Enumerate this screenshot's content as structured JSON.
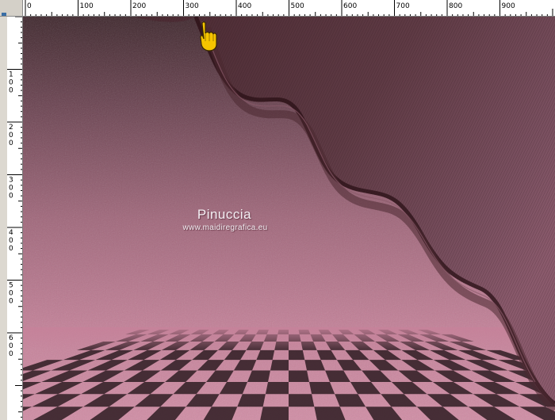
{
  "rulers": {
    "horizontal_labels": [
      "0",
      "100",
      "200",
      "300",
      "400",
      "500",
      "600",
      "700",
      "800",
      "900"
    ],
    "vertical_labels": [
      [
        "1",
        "0",
        "0"
      ],
      [
        "2",
        "0",
        "0"
      ],
      [
        "3",
        "0",
        "0"
      ],
      [
        "4",
        "0",
        "0"
      ],
      [
        "5",
        "0",
        "0"
      ],
      [
        "6",
        "0",
        "0"
      ]
    ]
  },
  "watermark": {
    "name": "Pinuccia",
    "url": "www.maidiregrafica.eu"
  },
  "icons": {
    "cursor": "pointing-hand-icon"
  },
  "colors": {
    "dark_top": "#4a2e34",
    "mid_pink": "#b66a82",
    "light_pink": "#d68ca4",
    "ribbon_dark": "#3a1e26",
    "cursor_yellow": "#f5c400"
  }
}
